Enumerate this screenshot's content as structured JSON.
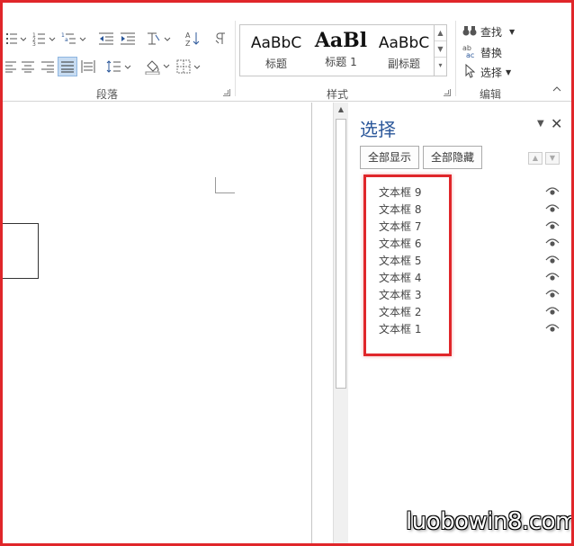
{
  "ribbon": {
    "groups": {
      "paragraph": "段落",
      "styles": "样式",
      "editing": "编辑"
    },
    "styles_gallery": [
      {
        "sample": "AaBbC",
        "name": "标题"
      },
      {
        "sample": "AaBl",
        "name": "标题 1"
      },
      {
        "sample": "AaBbC",
        "name": "副标题"
      }
    ],
    "editing": {
      "find": "查找",
      "replace": "替换",
      "select": "选择"
    }
  },
  "selection_pane": {
    "title": "选择",
    "show_all": "全部显示",
    "hide_all": "全部隐藏",
    "items": [
      "文本框 9",
      "文本框 8",
      "文本框 7",
      "文本框 6",
      "文本框 5",
      "文本框 4",
      "文本框 3",
      "文本框 2",
      "文本框 1"
    ]
  },
  "watermark": "luobowin8.com",
  "colors": {
    "highlight": "#e0262a",
    "pane_title": "#2b579a"
  }
}
